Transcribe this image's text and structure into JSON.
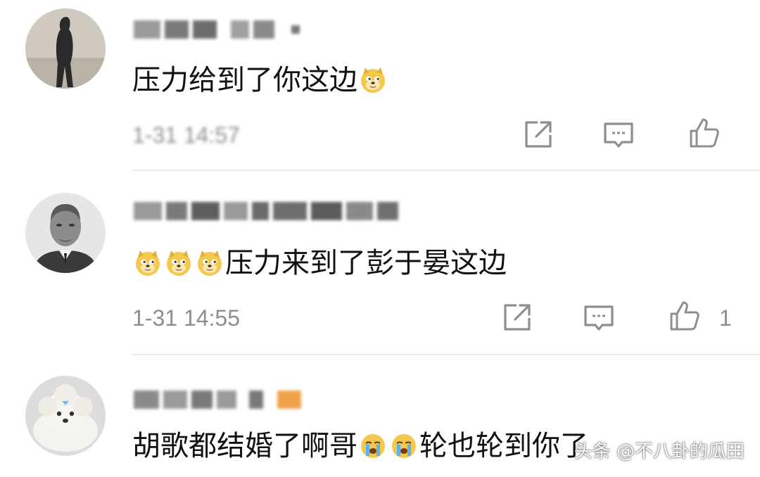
{
  "comments": [
    {
      "text": "压力给到了你这边",
      "trailing_emoji": [
        "doge-emoji"
      ],
      "timestamp": "1-31 14:57",
      "timestamp_blurred": true,
      "like_count": ""
    },
    {
      "leading_emoji": [
        "doge-emoji",
        "doge-emoji",
        "doge-emoji"
      ],
      "text": "压力来到了彭于晏这边",
      "timestamp": "1-31 14:55",
      "timestamp_blurred": false,
      "like_count": "1"
    },
    {
      "text_before": "胡歌都结婚了啊哥",
      "middle_emoji": [
        "crying-emoji",
        "crying-emoji"
      ],
      "text_after": "轮也轮到你了"
    }
  ],
  "watermark": "头条 @不八卦的瓜田",
  "colors": {
    "text": "#111111",
    "meta": "#8e8e8e",
    "divider": "#ececec",
    "emoji_face": "#f2c94c"
  }
}
